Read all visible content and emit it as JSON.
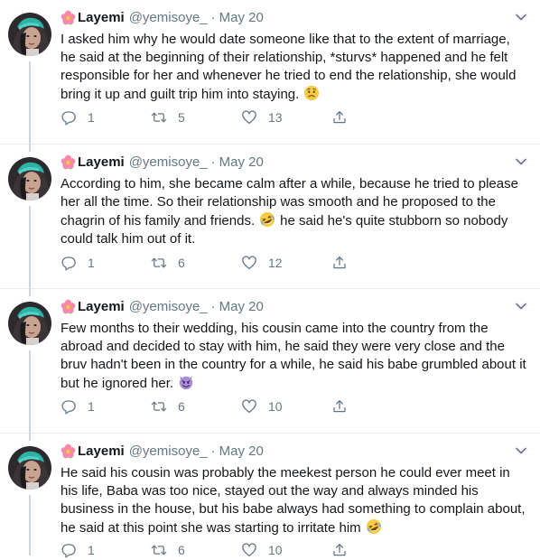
{
  "accent": "#1da1f2",
  "tweets": [
    {
      "name": "Layemi",
      "handle": "@yemisoye_",
      "separator": "·",
      "date": "May 20",
      "text": "I asked him why he would date someone like that to the extent of marriage, he said at the beginning of their relationship, *sturvs* happened and he felt responsible for her and whenever he tried to end the relationship, she would bring it up and guilt trip him into staying.",
      "emoji": "worried-face",
      "replies": "1",
      "retweets": "5",
      "likes": "13"
    },
    {
      "name": "Layemi",
      "handle": "@yemisoye_",
      "separator": "·",
      "date": "May 20",
      "text_a": "According to him, she became calm after a while, because he tried to please her all the time. So their relationship was smooth and he proposed to the chagrin of his family and friends.",
      "emoji": "rofl-face",
      "text_b": "he said he's quite stubborn so nobody could talk him out of it.",
      "replies": "1",
      "retweets": "6",
      "likes": "12"
    },
    {
      "name": "Layemi",
      "handle": "@yemisoye_",
      "separator": "·",
      "date": "May 20",
      "text": "Few months to their wedding, his cousin came into the country from the abroad and decided to stay with him, he said they were very close and the bruv hadn't been in the country for a while, he said his babe grumbled about it but he ignored her.",
      "emoji": "smiling-devil",
      "replies": "1",
      "retweets": "6",
      "likes": "10"
    },
    {
      "name": "Layemi",
      "handle": "@yemisoye_",
      "separator": "·",
      "date": "May 20",
      "text": "He said his cousin was probably the meekest person he could ever meet in his life, Baba was too nice, stayed out the way and always minded his business in the house, but his babe always had something to complain about, he said at this point she was starting to irritate him",
      "emoji": "rofl-face",
      "replies": "1",
      "retweets": "6",
      "likes": "10"
    }
  ]
}
